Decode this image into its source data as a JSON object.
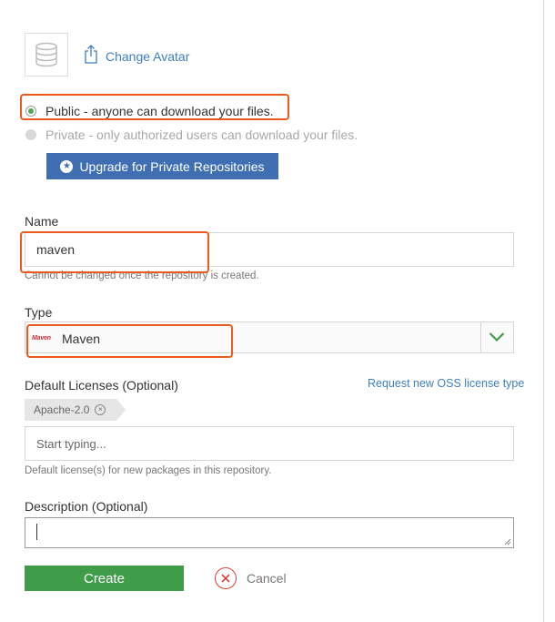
{
  "avatar": {
    "icon": "database-icon",
    "change_label": "Change Avatar",
    "change_icon": "share-upload-icon"
  },
  "visibility": {
    "public_label": "Public - anyone can download your files.",
    "private_label": "Private - only authorized users can download your files.",
    "selected": "public"
  },
  "upgrade_button": {
    "label": "Upgrade for Private Repositories",
    "icon": "star-circle-icon"
  },
  "name": {
    "label": "Name",
    "value": "maven",
    "hint": "Cannot be changed once the repository is created."
  },
  "type": {
    "label": "Type",
    "value": "Maven",
    "logo_text": "Maven",
    "dropdown_icon": "chevron-down-icon"
  },
  "licenses": {
    "label": "Default Licenses (Optional)",
    "oss_link": "Request new OSS license type",
    "tags": [
      "Apache-2.0"
    ],
    "placeholder": "Start typing...",
    "hint": "Default license(s) for new packages in this repository."
  },
  "description": {
    "label": "Description (Optional)",
    "value": ""
  },
  "actions": {
    "create_label": "Create",
    "cancel_label": "Cancel"
  },
  "colors": {
    "link": "#3f7fbf",
    "upgrade_button": "#3f6fb2",
    "create_button": "#3f9d4a",
    "cancel_icon": "#d9423a",
    "annotation": "#ec5a1f"
  }
}
